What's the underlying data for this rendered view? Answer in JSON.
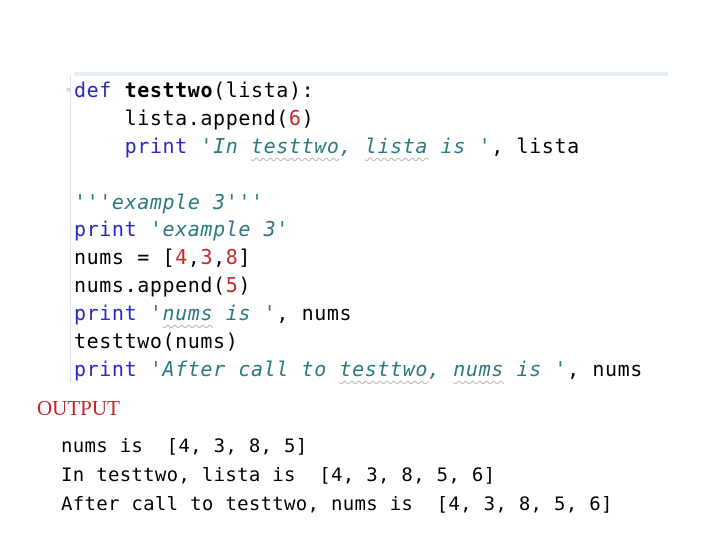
{
  "editor": {
    "fold_marker": "⊖",
    "lines": {
      "l1": {
        "kw": "def",
        "fn": "testtwo",
        "rest": "(lista):"
      },
      "l2": {
        "pre": "    lista.append(",
        "num": "6",
        "post": ")"
      },
      "l3": {
        "kw": "    print ",
        "str_a": "'In ",
        "str_b": "testtwo",
        "str_c": ", ",
        "str_d": "lista",
        "str_e": " is '",
        "post": ", lista"
      },
      "l4": {
        "str": "'''example 3'''"
      },
      "l5": {
        "kw": "print ",
        "str": "'example 3'"
      },
      "l6": {
        "pre": "nums = [",
        "n1": "4",
        "c1": ",",
        "n2": "3",
        "c2": ",",
        "n3": "8",
        "post": "]"
      },
      "l7": {
        "pre": "nums.append(",
        "num": "5",
        "post": ")"
      },
      "l8": {
        "kw": "print ",
        "str_a": "'",
        "str_b": "nums",
        "str_c": " is '",
        "post": ", nums"
      },
      "l9": {
        "text": "testtwo(nums)"
      },
      "l10": {
        "kw": "print ",
        "str_a": "'After call to ",
        "str_b": "testtwo",
        "str_c": ", ",
        "str_d": "nums",
        "str_e": " is '",
        "post": ", nums"
      }
    }
  },
  "output": {
    "title": "OUTPUT",
    "lines": [
      "nums is  [4, 3, 8, 5]",
      "In testtwo, lista is  [4, 3, 8, 5, 6]",
      "After call to testtwo, nums is  [4, 3, 8, 5, 6]"
    ]
  }
}
